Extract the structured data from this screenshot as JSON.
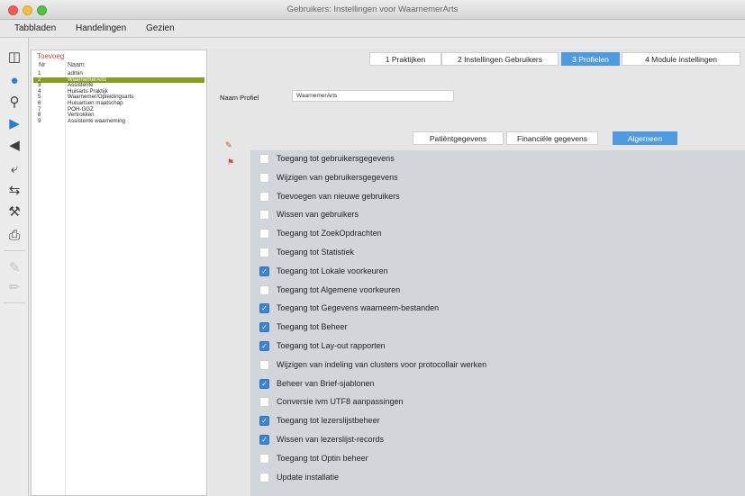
{
  "window": {
    "title": "Gebruikers: Instellingen voor WaarnemerArts"
  },
  "menubar": {
    "items": [
      "Tabbladen",
      "Handelingen",
      "Gezien"
    ]
  },
  "toolbar": {
    "icons": [
      "panel-icon",
      "globe-icon",
      "search-icon",
      "play-icon",
      "back-icon",
      "share-icon",
      "export-icon",
      "wrench-icon",
      "print-icon",
      "pen-icon",
      "pen-small-icon"
    ]
  },
  "list": {
    "title": "Toevoeg",
    "headers": {
      "nr": "Nr",
      "naam": "Naam"
    },
    "rows": [
      {
        "nr": "1",
        "naam": "admin"
      },
      {
        "nr": "2",
        "naam": "WaarnemerArts",
        "selected": true
      },
      {
        "nr": "3",
        "naam": "Assistente"
      },
      {
        "nr": "4",
        "naam": "Huisarts Praktijk"
      },
      {
        "nr": "5",
        "naam": "Waarnemer/Opleidingsarts"
      },
      {
        "nr": "6",
        "naam": "Huisartsen maatschap"
      },
      {
        "nr": "7",
        "naam": "POH-GGZ"
      },
      {
        "nr": "8",
        "naam": "Vertrokken"
      },
      {
        "nr": "9",
        "naam": "Assistente waarneming"
      }
    ]
  },
  "tabs": [
    {
      "label": "1 Praktijken",
      "active": false
    },
    {
      "label": "2 Instellingen Gebruikers",
      "active": false
    },
    {
      "label": "3 Profielen",
      "active": true
    },
    {
      "label": "4 Module instellingen",
      "active": false
    }
  ],
  "profile": {
    "label": "Naam Profiel",
    "value": "WaarnemerArts"
  },
  "subtabs": [
    {
      "label": "Patiëntgegevens",
      "active": false
    },
    {
      "label": "Financiële gegevens",
      "active": false
    },
    {
      "label": "Algemeen",
      "active": true
    }
  ],
  "permissions": [
    {
      "label": "Toegang tot gebruikersgegevens",
      "checked": false
    },
    {
      "label": "Wijzigen van gebruikersgegevens",
      "checked": false
    },
    {
      "label": "Toevoegen van nieuwe gebruikers",
      "checked": false
    },
    {
      "label": "Wissen van gebruikers",
      "checked": false
    },
    {
      "label": "Toegang tot ZoekOpdrachten",
      "checked": false
    },
    {
      "label": "Toegang tot Statistiek",
      "checked": false
    },
    {
      "label": "Toegang tot Lokale voorkeuren",
      "checked": true
    },
    {
      "label": "Toegang tot Algemene voorkeuren",
      "checked": false
    },
    {
      "label": "Toegang tot Gegevens waarneem-bestanden",
      "checked": true
    },
    {
      "label": "Toegang tot Beheer",
      "checked": true
    },
    {
      "label": "Toegang tot Lay-out rapporten",
      "checked": true
    },
    {
      "label": "Wijzigen van indeling van clusters voor protocollair werken",
      "checked": false
    },
    {
      "label": "Beheer van Brief-sjablonen",
      "checked": true
    },
    {
      "label": "Conversie ivm UTF8 aanpassingen",
      "checked": false
    },
    {
      "label": "Toegang tot lezerslijstbeheer",
      "checked": true
    },
    {
      "label": "Wissen van lezerslijst-records",
      "checked": true
    },
    {
      "label": "Toegang tot Optin beheer",
      "checked": false
    },
    {
      "label": "Update installatie",
      "checked": false
    }
  ]
}
